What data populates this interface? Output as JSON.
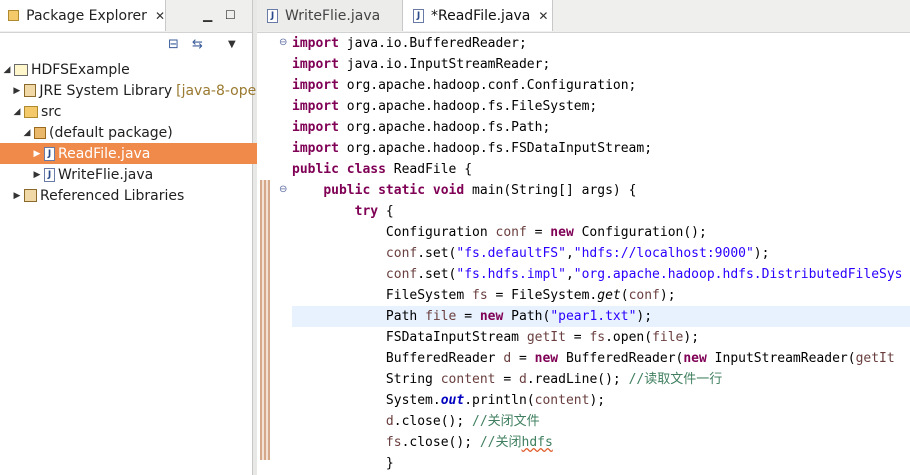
{
  "explorer": {
    "title": "Package Explorer",
    "tree": [
      {
        "label": "HDFSExample",
        "extra": ""
      },
      {
        "label": "JRE System Library",
        "extra": "[java-8-oper"
      },
      {
        "label": "src",
        "extra": ""
      },
      {
        "label": "(default package)",
        "extra": ""
      },
      {
        "label": "ReadFile.java",
        "extra": ""
      },
      {
        "label": "WriteFlie.java",
        "extra": ""
      },
      {
        "label": "Referenced Libraries",
        "extra": ""
      }
    ]
  },
  "editor": {
    "tabs": [
      {
        "label": "WriteFlie.java"
      },
      {
        "label": "*ReadFile.java"
      }
    ],
    "code": [
      {
        "kw": "import",
        "rest": " java.io.BufferedReader;"
      },
      {
        "kw": "import",
        "rest": " java.io.InputStreamReader;"
      },
      {
        "kw": "import",
        "rest": " org.apache.hadoop.conf.Configuration;"
      },
      {
        "kw": "import",
        "rest": " org.apache.hadoop.fs.FileSystem;"
      },
      {
        "kw": "import",
        "rest": " org.apache.hadoop.fs.Path;"
      },
      {
        "kw": "import",
        "rest": " org.apache.hadoop.fs.FSDataInputStream;"
      },
      {
        "kw1": "public",
        "kw2": "class",
        "rest": " ReadFile {"
      },
      {
        "indent": "    ",
        "kw1": "public",
        "kw2": "static",
        "kw3": "void",
        "rest": " main(String[] args) {"
      },
      {
        "indent": "        ",
        "kw": "try",
        "rest": " {"
      },
      {
        "indent": "            ",
        "a": "Configuration ",
        "v": "conf",
        "b": " = ",
        "k": "new",
        "c": " Configuration();"
      },
      {
        "indent": "            ",
        "v": "conf",
        "a": ".set(",
        "s1": "\"fs.defaultFS\"",
        "b": ",",
        "s2": "\"hdfs://localhost:9000\"",
        "c": ");"
      },
      {
        "indent": "            ",
        "v": "conf",
        "a": ".set(",
        "s1": "\"fs.hdfs.impl\"",
        "b": ",",
        "s2": "\"org.apache.hadoop.hdfs.DistributedFileSys"
      },
      {
        "indent": "            ",
        "a": "FileSystem ",
        "v": "fs",
        "b": " = FileSystem.",
        "i": "get",
        "c": "(",
        "v2": "conf",
        "d": ");"
      },
      {
        "indent": "            ",
        "a": "Path ",
        "v": "file",
        "b": " = ",
        "k": "new",
        "c": " Path(",
        "s": "\"pear1.txt\"",
        "d": ");"
      },
      {
        "indent": "            ",
        "a": "FSDataInputStream ",
        "v": "getIt",
        "b": " = ",
        "v2": "fs",
        "c": ".open(",
        "v3": "file",
        "d": ");"
      },
      {
        "indent": "            ",
        "a": "BufferedReader ",
        "v": "d",
        "b": " = ",
        "k": "new",
        "c": " BufferedReader(",
        "k2": "new",
        "d": " InputStreamReader(",
        "v2": "getIt"
      },
      {
        "indent": "            ",
        "a": "String ",
        "v": "content",
        "b": " = ",
        "v2": "d",
        "c": ".readLine(); ",
        "cm": "//读取文件一行"
      },
      {
        "indent": "            ",
        "a": "System.",
        "st": "out",
        "b": ".println(",
        "v": "content",
        "c": ");"
      },
      {
        "indent": "            ",
        "v": "d",
        "a": ".close(); ",
        "cm": "//关闭文件"
      },
      {
        "indent": "            ",
        "v": "fs",
        "a": ".close(); ",
        "cm": "//关闭",
        "sq": "hdfs"
      },
      {
        "indent": "            ",
        "a": "}"
      }
    ]
  }
}
